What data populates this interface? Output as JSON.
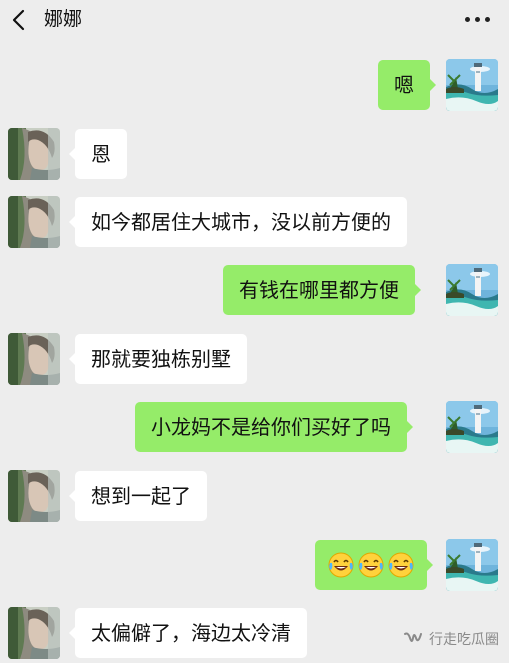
{
  "header": {
    "title": "娜娜",
    "back_icon": "chevron-left-icon",
    "more_icon": "more-dots-icon"
  },
  "messages": [
    {
      "side": "right",
      "text": "嗯"
    },
    {
      "side": "left",
      "text": "恩"
    },
    {
      "side": "left",
      "text": "如今都居住大城市，没以前方便的"
    },
    {
      "side": "right",
      "text": "有钱在哪里都方便"
    },
    {
      "side": "left",
      "text": "那就要独栋别墅"
    },
    {
      "side": "right",
      "text": "小龙妈不是给你们买好了吗"
    },
    {
      "side": "left",
      "text": "想到一起了"
    },
    {
      "side": "right",
      "emoji": [
        "laugh-tears-emoji",
        "laugh-tears-emoji",
        "laugh-tears-emoji"
      ]
    },
    {
      "side": "left",
      "text": "太偏僻了，海边太冷清"
    }
  ],
  "watermark": {
    "text": "行走吃瓜圈",
    "icon": "wechat-channel-icon"
  },
  "colors": {
    "background": "#ededed",
    "bubble_self": "#95ec69",
    "bubble_other": "#ffffff"
  }
}
